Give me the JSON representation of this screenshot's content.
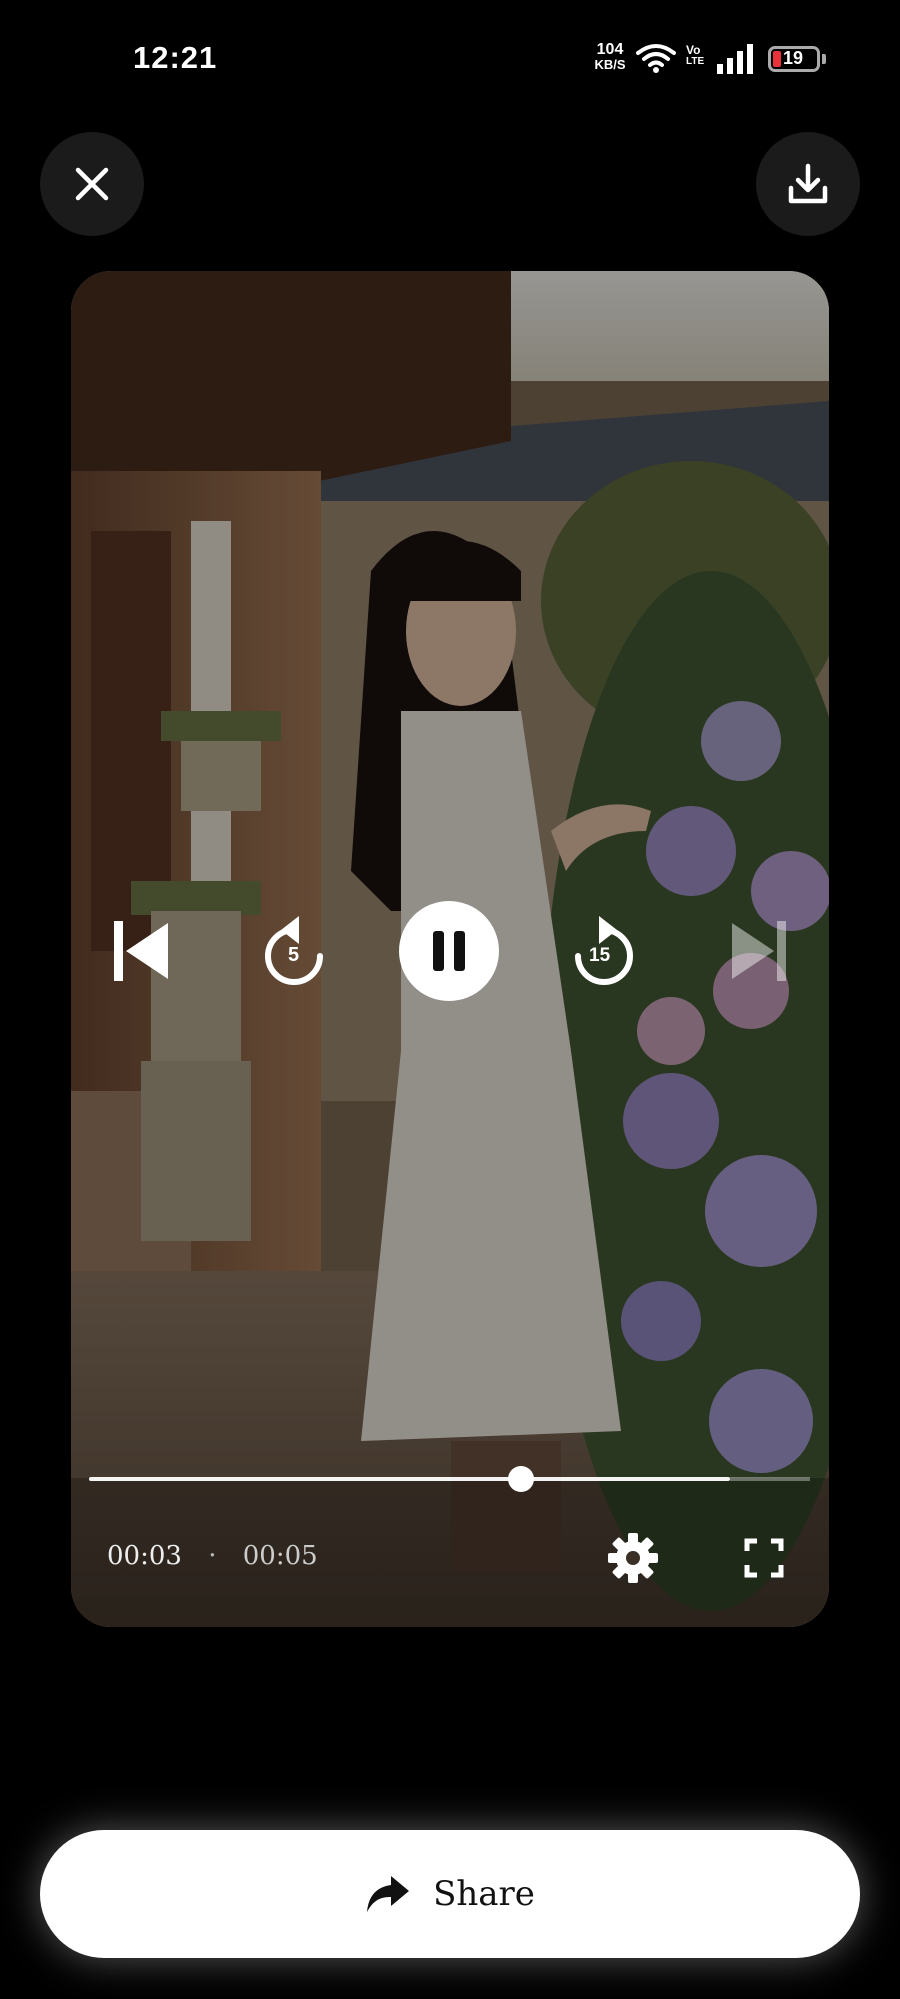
{
  "status_bar": {
    "time": "12:21",
    "net_speed_value": "104",
    "net_speed_unit": "KB/S",
    "volte_top": "Vo",
    "volte_bottom": "LTE",
    "battery_level": "19",
    "battery_color": "#e8333b"
  },
  "header": {
    "close_icon": "close-icon",
    "download_icon": "download-icon"
  },
  "player": {
    "controls": {
      "prev_icon": "skip-previous-icon",
      "rewind_seconds": "5",
      "play_state_icon": "pause-icon",
      "forward_seconds": "15",
      "next_icon": "skip-next-icon"
    },
    "progress_fraction": 0.6,
    "current_time": "00:03",
    "separator": "·",
    "duration": "00:05",
    "settings_icon": "gear-icon",
    "fullscreen_icon": "fullscreen-icon"
  },
  "share": {
    "label": "Share",
    "icon": "share-arrow-icon"
  }
}
